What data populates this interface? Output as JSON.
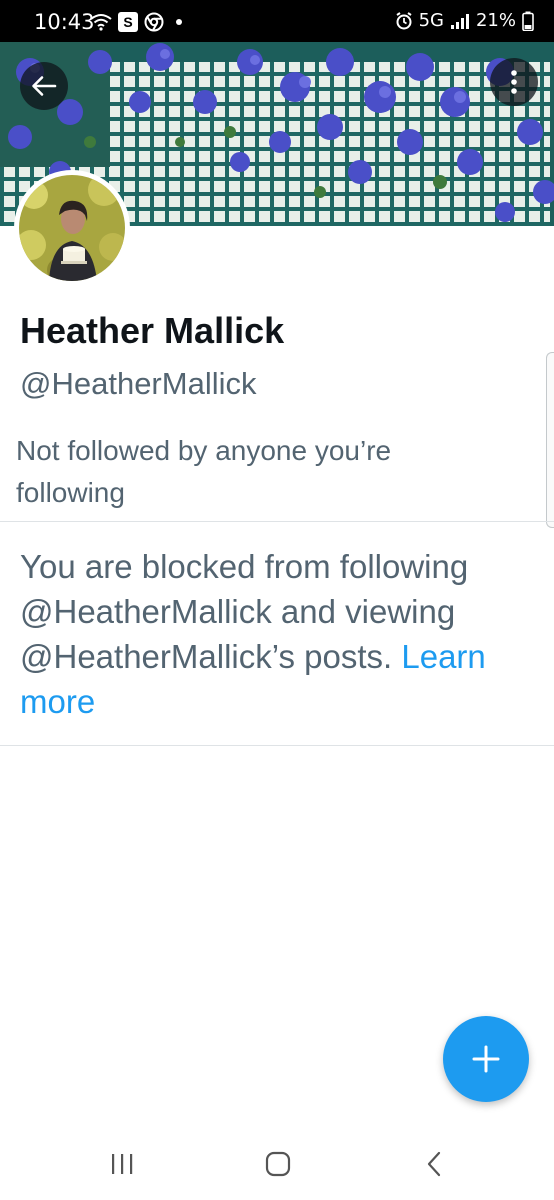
{
  "status_bar": {
    "time": "10:43",
    "s_badge": "S",
    "network": "5G",
    "battery": "21%"
  },
  "profile": {
    "display_name": "Heather Mallick",
    "handle": "@HeatherMallick",
    "followers_note": "Not followed by anyone you’re following"
  },
  "blocked": {
    "message": "You are blocked from following @HeatherMallick and viewing @HeatherMallick’s posts.",
    "link_label": "Learn more"
  },
  "colors": {
    "accent": "#1d9bf0",
    "secondary_text": "#536471",
    "primary_text": "#0f1419"
  },
  "icons": {
    "back": "arrow-left-icon",
    "more": "more-vertical-icon",
    "compose": "plus-icon",
    "nav_recents": "recents-icon",
    "nav_home": "home-icon",
    "nav_back": "chevron-left-icon"
  }
}
